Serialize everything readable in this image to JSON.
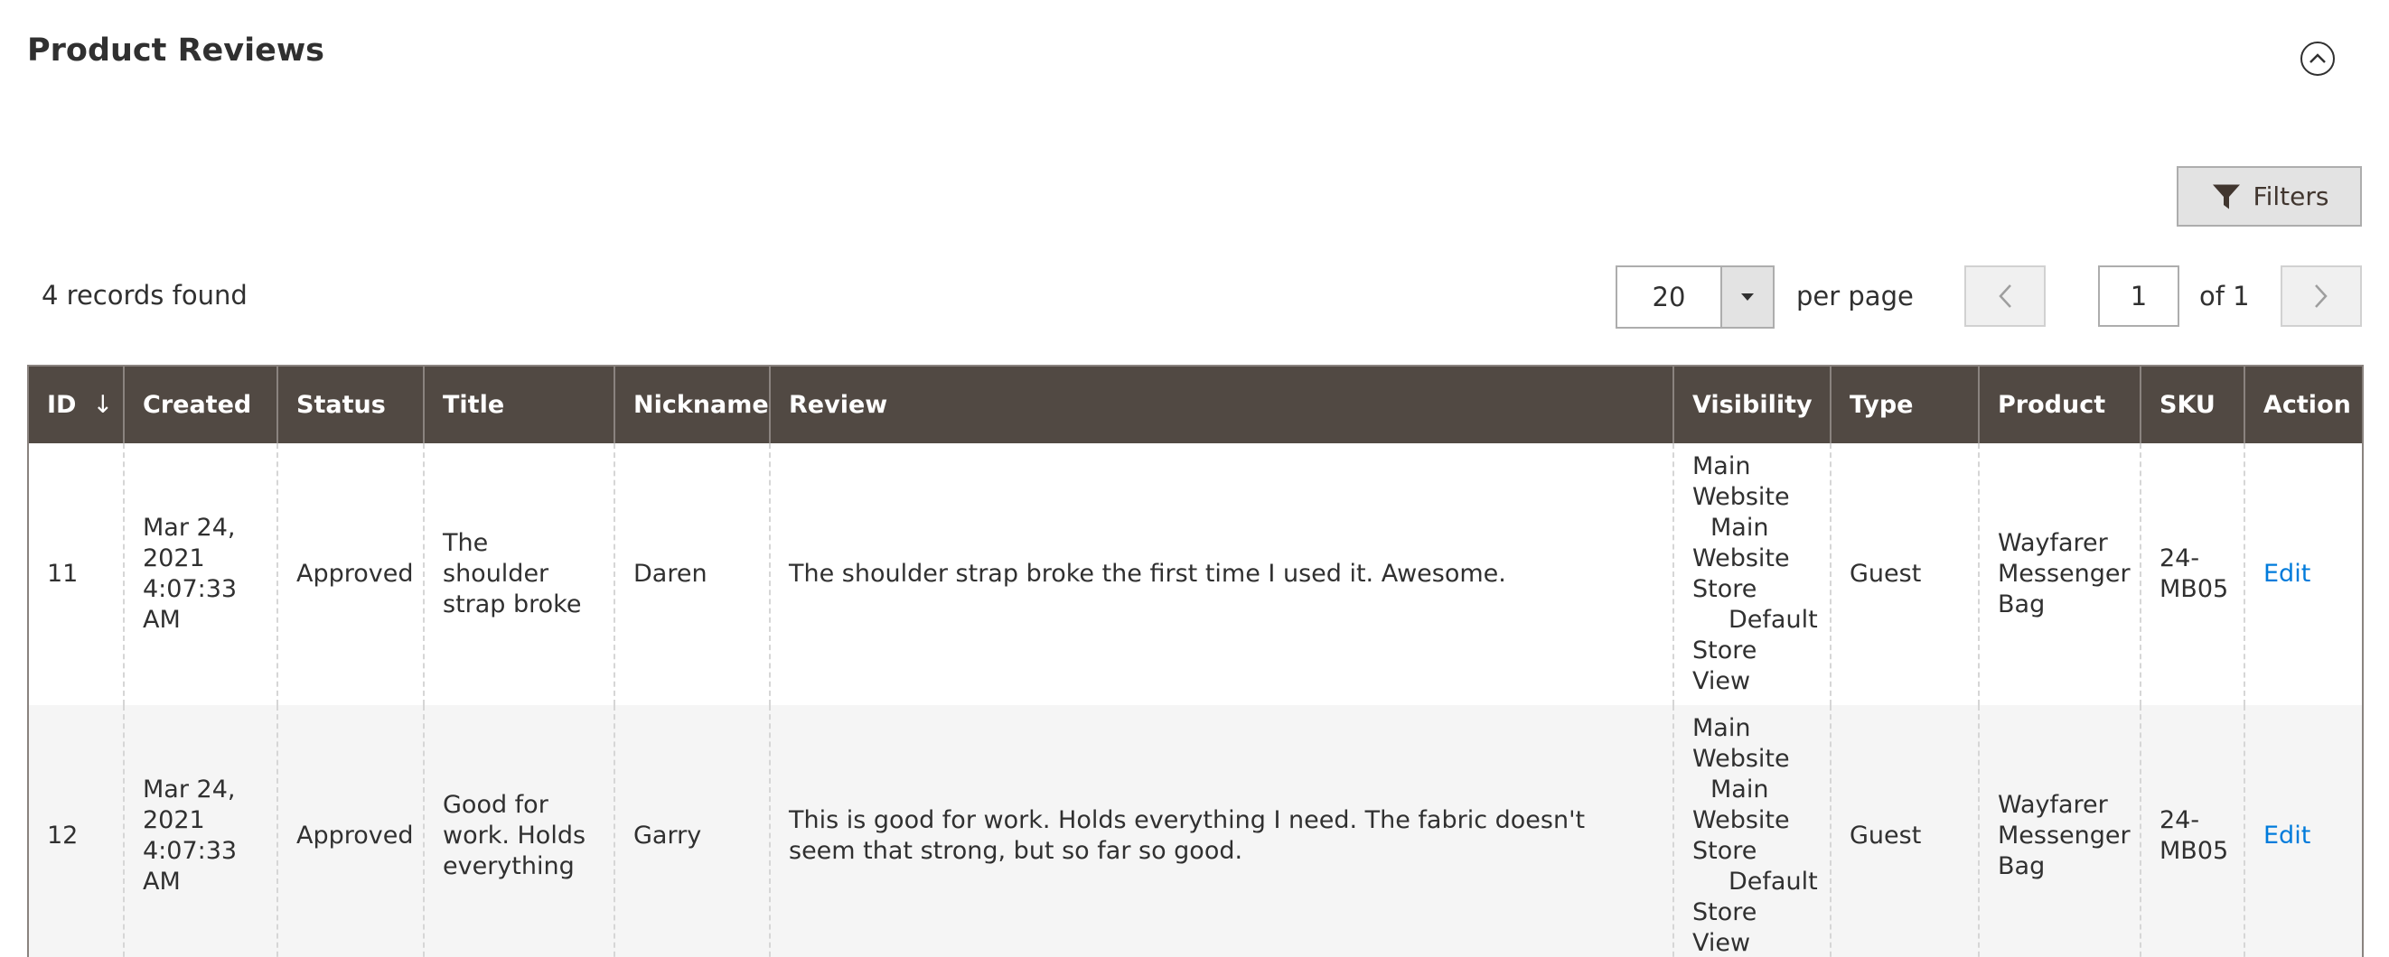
{
  "section": {
    "title": "Product Reviews",
    "collapse_icon": "chevron-up-circle-icon"
  },
  "filters_button": {
    "label": "Filters",
    "icon": "funnel-icon"
  },
  "toolbar": {
    "records_found": "4 records found",
    "per_page_value": "20",
    "per_page_label": "per page",
    "current_page": "1",
    "page_of": "of 1"
  },
  "grid": {
    "columns": {
      "id": "ID",
      "created": "Created",
      "status": "Status",
      "title": "Title",
      "nickname": "Nickname",
      "review": "Review",
      "visibility": "Visibility",
      "type": "Type",
      "product": "Product",
      "sku": "SKU",
      "action": "Action"
    },
    "sort_indicator": "↓",
    "rows": [
      {
        "id": "11",
        "created": "Mar 24, 2021 4:07:33 AM",
        "status": "Approved",
        "title": "The shoulder strap broke",
        "nickname": "Daren",
        "review": "The shoulder strap broke the first time I used it. Awesome.",
        "visibility": [
          "Main Website",
          "Main Website Store",
          "Default Store View"
        ],
        "type": "Guest",
        "product": "Wayfarer Messenger Bag",
        "sku": "24-MB05",
        "action": "Edit"
      },
      {
        "id": "12",
        "created": "Mar 24, 2021 4:07:33 AM",
        "status": "Approved",
        "title": "Good for work. Holds everything",
        "nickname": "Garry",
        "review": "This is good for work. Holds everything I need. The fabric doesn't seem that strong, but so far so good.",
        "visibility": [
          "Main Website",
          "Main Website Store",
          "Default Store View"
        ],
        "type": "Guest",
        "product": "Wayfarer Messenger Bag",
        "sku": "24-MB05",
        "action": "Edit"
      }
    ]
  },
  "colors": {
    "header_bg": "#514943",
    "link": "#007bdb",
    "alt_row": "#f5f5f5"
  }
}
